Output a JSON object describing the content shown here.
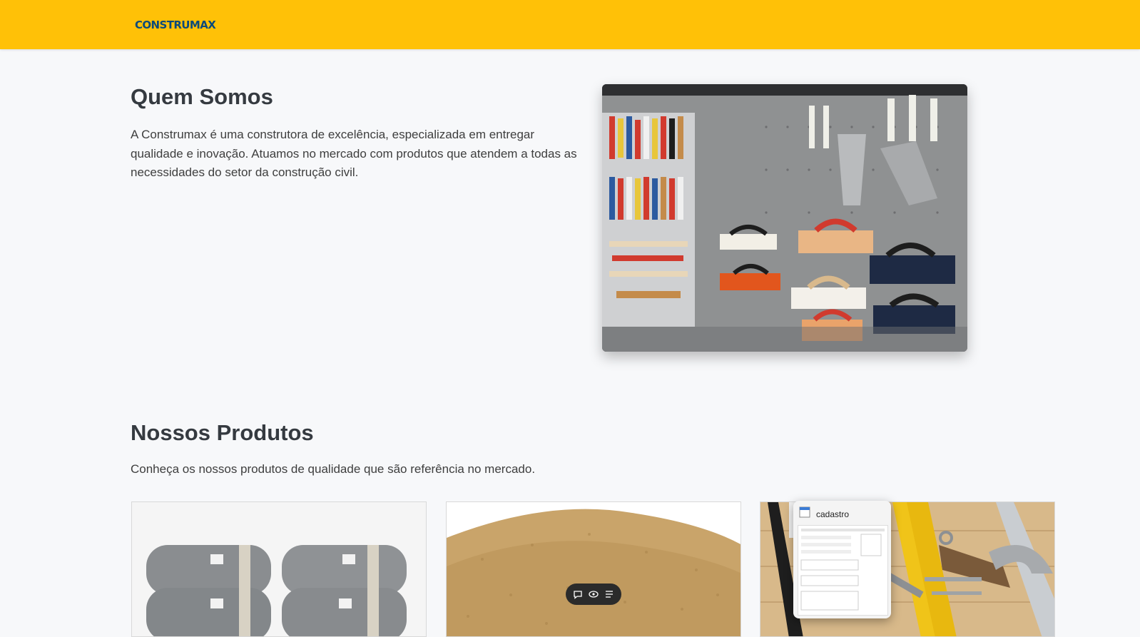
{
  "header": {
    "logo_text": "CONSTRUMAX",
    "bg_color": "#ffc107",
    "logo_color": "#0b4a7a"
  },
  "about": {
    "title": "Quem Somos",
    "text": "A Construmax é uma construtora de excelência, especializada em entregar qualidade e inovação. Atuamos no mercado com produtos que atendem a todas as necessidades do setor da construção civil.",
    "image_icon": "tool-store-photo"
  },
  "products": {
    "title": "Nossos Produtos",
    "text": "Conheça os nossos produtos de qualidade que são referência no mercado.",
    "cards": [
      {
        "image_icon": "cement-bags-photo"
      },
      {
        "image_icon": "sand-pile-photo"
      },
      {
        "image_icon": "hand-tools-photo"
      }
    ]
  },
  "toolbar": {
    "icons": [
      "comment-icon",
      "view-icon",
      "menu-icon"
    ]
  },
  "popup": {
    "title": "cadastro",
    "icon": "form-window-icon"
  }
}
